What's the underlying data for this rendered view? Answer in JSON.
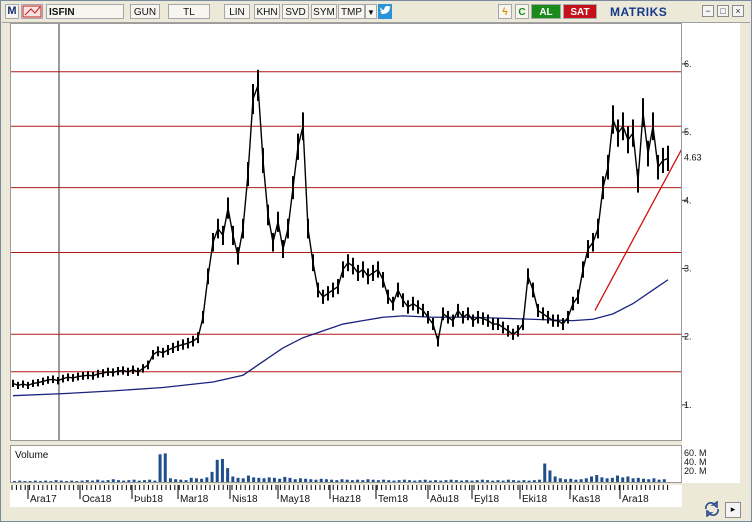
{
  "toolbar": {
    "logo_glyph": "M",
    "symbol": "ISFIN",
    "period": "GUN",
    "currency": "TL",
    "scale": "LIN",
    "khn": "KHN",
    "svd": "SVD",
    "sym": "SYM",
    "tmp": "TMP",
    "c_btn": "C",
    "buy": "AL",
    "sell": "SAT",
    "brand": "MATRIKS"
  },
  "window_buttons": [
    "−",
    "□",
    "×"
  ],
  "volume": {
    "title": "Volume",
    "ticks": [
      "60. M",
      "40. M",
      "20. M"
    ]
  },
  "chart_data": {
    "type": "line",
    "title": "",
    "current_value_label": "4.63",
    "y_ticks": [
      "6.",
      "5.",
      "4.",
      "3.",
      "2.",
      "1."
    ],
    "ylim": [
      0.5,
      6.6
    ],
    "x_ticks": [
      "Ara17",
      "Oca18",
      "Þub18",
      "Mar18",
      "Nis18",
      "May18",
      "Haz18",
      "Tem18",
      "Aðu18",
      "Eyl18",
      "Eki18",
      "Kas18",
      "Ara18"
    ],
    "horizontal_levels": [
      5.9,
      5.1,
      4.2,
      3.25,
      2.05,
      1.5
    ],
    "price": {
      "x": [
        0,
        5,
        10,
        15,
        20,
        25,
        30,
        35,
        40,
        45,
        50,
        55,
        60,
        65,
        70,
        75,
        80,
        85,
        90,
        95,
        100,
        105,
        110,
        115,
        120,
        125,
        130,
        135,
        140,
        145,
        150,
        155,
        160,
        165,
        170,
        175,
        180,
        185,
        190,
        195,
        200,
        205,
        210,
        215,
        220,
        225,
        230,
        235,
        240,
        245,
        250,
        255,
        260,
        265,
        270,
        275,
        280,
        285,
        290,
        295,
        300,
        305,
        310,
        315,
        320,
        325,
        330,
        335,
        340,
        345,
        350,
        355,
        360,
        365,
        370,
        375,
        380,
        385,
        390,
        395,
        400,
        405,
        410,
        415,
        420,
        425,
        430,
        435,
        440,
        445,
        450,
        455,
        460,
        465,
        470,
        475,
        480,
        485,
        490,
        495,
        500,
        505,
        510,
        515,
        520,
        525,
        530,
        535,
        540,
        545,
        550,
        555,
        560,
        565,
        570,
        575,
        580,
        585,
        590,
        595,
        600,
        605,
        610,
        615,
        620,
        625,
        630,
        635,
        640,
        645,
        650,
        655
      ],
      "y": [
        1.33,
        1.3,
        1.32,
        1.3,
        1.33,
        1.34,
        1.36,
        1.38,
        1.39,
        1.37,
        1.4,
        1.42,
        1.41,
        1.43,
        1.44,
        1.45,
        1.44,
        1.47,
        1.48,
        1.5,
        1.49,
        1.51,
        1.52,
        1.5,
        1.53,
        1.5,
        1.55,
        1.6,
        1.75,
        1.8,
        1.78,
        1.82,
        1.85,
        1.88,
        1.9,
        1.92,
        1.95,
        2.0,
        2.3,
        2.9,
        3.4,
        3.6,
        3.5,
        3.9,
        3.5,
        3.2,
        3.6,
        4.4,
        5.5,
        5.7,
        4.6,
        3.8,
        3.4,
        3.7,
        3.3,
        3.6,
        4.2,
        4.8,
        5.1,
        3.6,
        3.1,
        2.7,
        2.6,
        2.65,
        2.7,
        2.75,
        3.0,
        3.1,
        3.05,
        2.95,
        3.0,
        2.9,
        2.95,
        3.0,
        2.85,
        2.6,
        2.5,
        2.7,
        2.55,
        2.45,
        2.5,
        2.45,
        2.4,
        2.3,
        2.2,
        1.95,
        2.35,
        2.3,
        2.25,
        2.4,
        2.3,
        2.35,
        2.25,
        2.3,
        2.28,
        2.25,
        2.2,
        2.2,
        2.15,
        2.1,
        2.05,
        2.1,
        2.2,
        2.9,
        2.7,
        2.4,
        2.35,
        2.3,
        2.25,
        2.25,
        2.2,
        2.3,
        2.5,
        2.6,
        3.0,
        3.3,
        3.4,
        3.6,
        4.2,
        4.5,
        5.2,
        5.0,
        5.1,
        4.9,
        5.0,
        4.3,
        5.3,
        4.7,
        5.1,
        4.5,
        4.6,
        4.63
      ]
    },
    "moving_average": {
      "x": [
        0,
        50,
        100,
        150,
        200,
        230,
        250,
        270,
        290,
        310,
        330,
        350,
        370,
        390,
        420,
        460,
        500,
        540,
        560,
        580,
        600,
        620,
        640,
        655
      ],
      "y": [
        1.15,
        1.18,
        1.22,
        1.27,
        1.35,
        1.45,
        1.65,
        1.85,
        2.0,
        2.1,
        2.2,
        2.25,
        2.3,
        2.32,
        2.3,
        2.3,
        2.28,
        2.26,
        2.25,
        2.27,
        2.35,
        2.5,
        2.7,
        2.85
      ]
    },
    "trendline": {
      "x": [
        582,
        670
      ],
      "y": [
        2.4,
        4.8
      ]
    },
    "volume_bars": [
      2,
      3,
      2,
      2,
      3,
      2,
      3,
      2,
      4,
      3,
      2,
      3,
      2,
      3,
      4,
      3,
      5,
      3,
      4,
      6,
      4,
      3,
      4,
      5,
      3,
      4,
      5,
      3,
      60,
      62,
      8,
      6,
      5,
      4,
      9,
      8,
      7,
      10,
      22,
      48,
      50,
      30,
      12,
      9,
      8,
      14,
      10,
      9,
      8,
      10,
      9,
      7,
      11,
      9,
      6,
      8,
      7,
      6,
      5,
      7,
      6,
      5,
      4,
      6,
      5,
      4,
      5,
      4,
      6,
      5,
      4,
      5,
      4,
      3,
      4,
      5,
      4,
      3,
      4,
      5,
      3,
      4,
      3,
      4,
      5,
      4,
      3,
      4,
      3,
      4,
      5,
      4,
      3,
      4,
      3,
      5,
      4,
      3,
      4,
      3,
      4,
      5,
      40,
      25,
      12,
      8,
      6,
      7,
      5,
      6,
      8,
      12,
      15,
      10,
      8,
      9,
      14,
      10,
      12,
      8,
      9,
      7,
      6,
      8,
      5,
      6
    ]
  }
}
